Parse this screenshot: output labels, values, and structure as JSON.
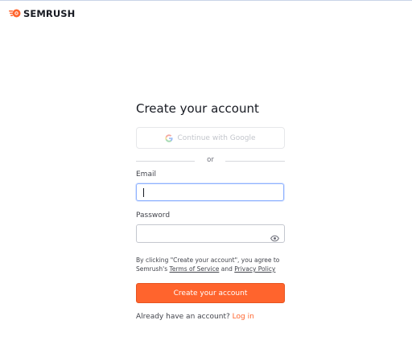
{
  "brand": {
    "name": "SEMRUSH",
    "logo_icon": "semrush-fireball-icon",
    "accent": "#ff642d"
  },
  "form": {
    "title": "Create your account",
    "google_button_label": "Continue with Google",
    "divider_text": "or",
    "email_label": "Email",
    "email_value": "",
    "password_label": "Password",
    "password_value": "",
    "terms_prefix": "By clicking \"Create your account\", you agree to Semrush's ",
    "terms_of_service": "Terms of Service",
    "terms_and": " and ",
    "privacy_policy": "Privacy Policy",
    "create_button_label": "Create your account",
    "signin_prompt": "Already have an account?",
    "login_link": "Log in"
  },
  "icons": {
    "google": "google-icon",
    "password_toggle": "eye-icon"
  }
}
